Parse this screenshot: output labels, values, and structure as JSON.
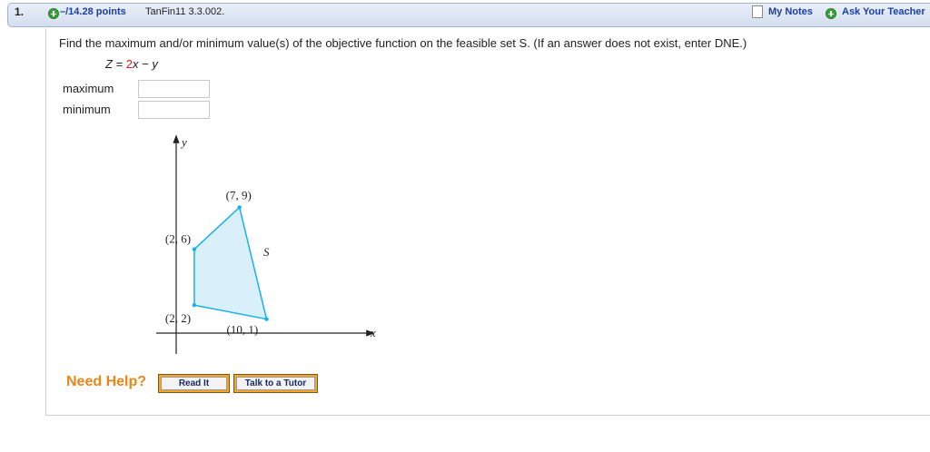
{
  "header": {
    "question_number": "1.",
    "points": "–/14.28 points",
    "problem_code": "TanFin11 3.3.002.",
    "my_notes": "My Notes",
    "ask_teacher": "Ask Your Teacher"
  },
  "question": {
    "prompt": "Find the maximum and/or minimum value(s) of the objective function on the feasible set S. (If an answer does not exist, enter DNE.)",
    "objective_prefix": "Z = ",
    "objective_coef": "2",
    "objective_rest": "x − y",
    "fields": [
      {
        "label": "maximum",
        "value": ""
      },
      {
        "label": "minimum",
        "value": ""
      }
    ]
  },
  "graph": {
    "axis_x": "x",
    "axis_y": "y",
    "region_label": "S",
    "vertices": [
      {
        "x": 2,
        "y": 2,
        "label": "(2, 2)"
      },
      {
        "x": 2,
        "y": 6,
        "label": "(2, 6)"
      },
      {
        "x": 7,
        "y": 9,
        "label": "(7, 9)"
      },
      {
        "x": 10,
        "y": 1,
        "label": "(10, 1)"
      }
    ],
    "fill_color": "#d9effa",
    "edge_color": "#19b2e6"
  },
  "help": {
    "title": "Need Help?",
    "read_it": "Read It",
    "talk_tutor": "Talk to a Tutor"
  }
}
